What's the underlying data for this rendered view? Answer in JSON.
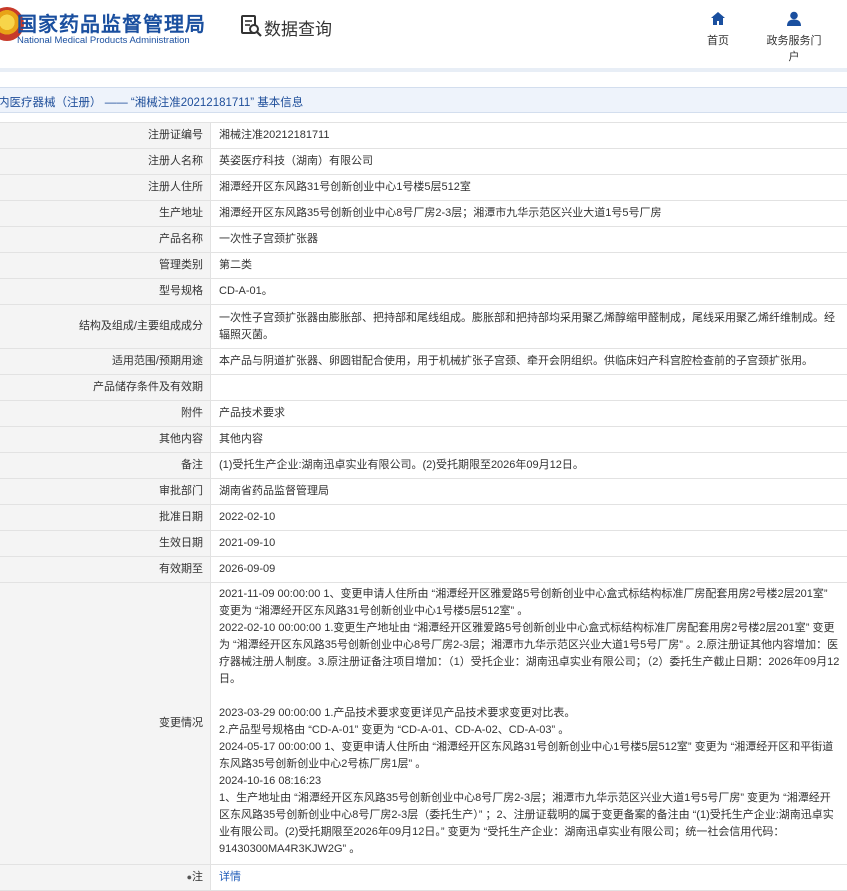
{
  "header": {
    "title": "国家药品监督管理局",
    "subtitle": "National Medical Products Administration",
    "query_label": "数据查询",
    "nav": [
      {
        "label": "首页",
        "icon": "home-icon"
      },
      {
        "label": "政务服务门户",
        "icon": "user-icon"
      }
    ]
  },
  "breadcrumb": {
    "text": "内医疗器械（注册） —— “湘械注准20212181711” 基本信息"
  },
  "colors": {
    "brand": "#1a4f9f",
    "crumb_bg": "#eef3fb",
    "label_bg": "#f4f4f4",
    "link": "#1e5bb8"
  },
  "rows": [
    {
      "label": "注册证编号",
      "value": "湘械注准20212181711"
    },
    {
      "label": "注册人名称",
      "value": "英姿医疗科技（湖南）有限公司"
    },
    {
      "label": "注册人住所",
      "value": "湘潭经开区东风路31号创新创业中心1号楼5层512室"
    },
    {
      "label": "生产地址",
      "value": "湘潭经开区东风路35号创新创业中心8号厂房2-3层；湘潭市九华示范区兴业大道1号5号厂房"
    },
    {
      "label": "产品名称",
      "value": "一次性子宫颈扩张器"
    },
    {
      "label": "管理类别",
      "value": "第二类"
    },
    {
      "label": "型号规格",
      "value": "CD-A-01。"
    },
    {
      "label": "结构及组成/主要组成成分",
      "value": "一次性子宫颈扩张器由膨胀部、把持部和尾线组成。膨胀部和把持部均采用聚乙烯醇缩甲醛制成，尾线采用聚乙烯纤维制成。经辐照灭菌。"
    },
    {
      "label": "适用范围/预期用途",
      "value": "本产品与阴道扩张器、卵圆钳配合使用，用于机械扩张子宫颈、牵开会阴组织。供临床妇产科宫腔检查前的子宫颈扩张用。"
    },
    {
      "label": "产品储存条件及有效期",
      "value": ""
    },
    {
      "label": "附件",
      "value": "产品技术要求"
    },
    {
      "label": "其他内容",
      "value": "其他内容"
    },
    {
      "label": "备注",
      "value": "(1)受托生产企业:湖南迅卓实业有限公司。(2)受托期限至2026年09月12日。"
    },
    {
      "label": "审批部门",
      "value": "湖南省药品监督管理局"
    },
    {
      "label": "批准日期",
      "value": "2022-02-10"
    },
    {
      "label": "生效日期",
      "value": "2021-09-10"
    },
    {
      "label": "有效期至",
      "value": "2026-09-09"
    }
  ],
  "changes": {
    "label": "变更情况",
    "lines": [
      "2021-11-09 00:00:00 1、变更申请人住所由 “湘潭经开区雅爱路5号创新创业中心盒式标结构标准厂房配套用房2号楼2层201室” 变更为 “湘潭经开区东风路31号创新创业中心1号楼5层512室” 。",
      "2022-02-10 00:00:00 1.变更生产地址由 “湘潭经开区雅爱路5号创新创业中心盒式标结构标准厂房配套用房2号楼2层201室” 变更为 “湘潭经开区东风路35号创新创业中心8号厂房2-3层；湘潭市九华示范区兴业大道1号5号厂房” 。2.原注册证其他内容增加：医疗器械注册人制度。3.原注册证备注项目增加：（1）受托企业：湖南迅卓实业有限公司；（2）委托生产截止日期：2026年09月12日。",
      "",
      "2023-03-29 00:00:00 1.产品技术要求变更详见产品技术要求变更对比表。",
      "2.产品型号规格由 “CD-A-01” 变更为 “CD-A-01、CD-A-02、CD-A-03” 。",
      "2024-05-17 00:00:00 1、变更申请人住所由 “湘潭经开区东风路31号创新创业中心1号楼5层512室” 变更为 “湘潭经开区和平街道东风路35号创新创业中心2号栋厂房1层” 。",
      "2024-10-16 08:16:23",
      "1、生产地址由 “湘潭经开区东风路35号创新创业中心8号厂房2-3层；湘潭市九华示范区兴业大道1号5号厂房” 变更为 “湘潭经开区东风路35号创新创业中心8号厂房2-3层（委托生产）” ；2、注册证载明的属于变更备案的备注由 “(1)受托生产企业:湖南迅卓实业有限公司。(2)受托期限至2026年09月12日。” 变更为 “受托生产企业：湖南迅卓实业有限公司；统一社会信用代码：91430300MA4R3KJW2G” 。"
    ]
  },
  "note": {
    "label": "注",
    "link": "详情"
  }
}
